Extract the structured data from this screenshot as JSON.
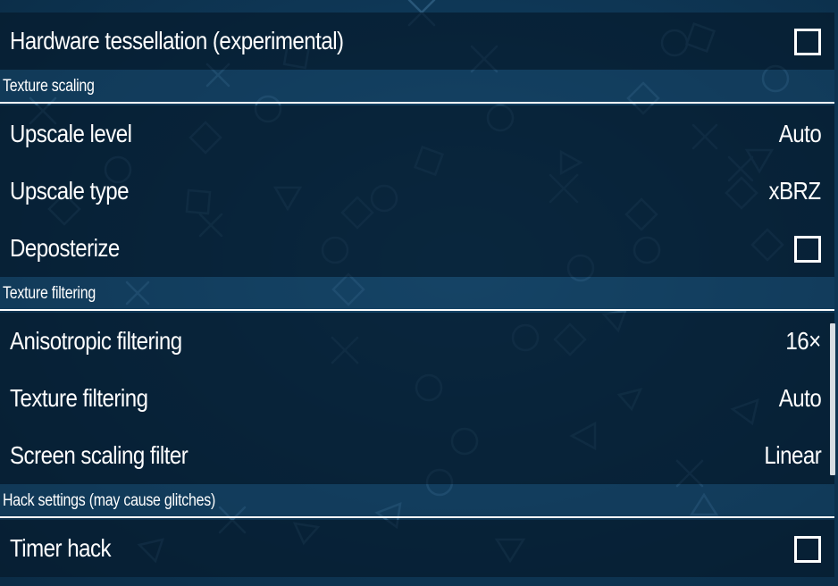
{
  "settings": {
    "hardware_tessellation": {
      "label": "Hardware tessellation (experimental)",
      "checked": false
    },
    "texture_scaling_header": "Texture scaling",
    "upscale_level": {
      "label": "Upscale level",
      "value": "Auto"
    },
    "upscale_type": {
      "label": "Upscale type",
      "value": "xBRZ"
    },
    "deposterize": {
      "label": "Deposterize",
      "checked": false
    },
    "texture_filtering_header": "Texture filtering",
    "anisotropic_filtering": {
      "label": "Anisotropic filtering",
      "value": "16×"
    },
    "texture_filtering": {
      "label": "Texture filtering",
      "value": "Auto"
    },
    "screen_scaling_filter": {
      "label": "Screen scaling filter",
      "value": "Linear"
    },
    "hack_settings_header": "Hack settings (may cause glitches)",
    "timer_hack": {
      "label": "Timer hack",
      "checked": false
    }
  },
  "colors": {
    "background": "#0f3a5a",
    "row_background": "#061a2c",
    "text": "#ffffff"
  },
  "icons": {
    "background_pattern": "playstation-shapes-pattern",
    "checkbox": "checkbox-unchecked-icon"
  }
}
